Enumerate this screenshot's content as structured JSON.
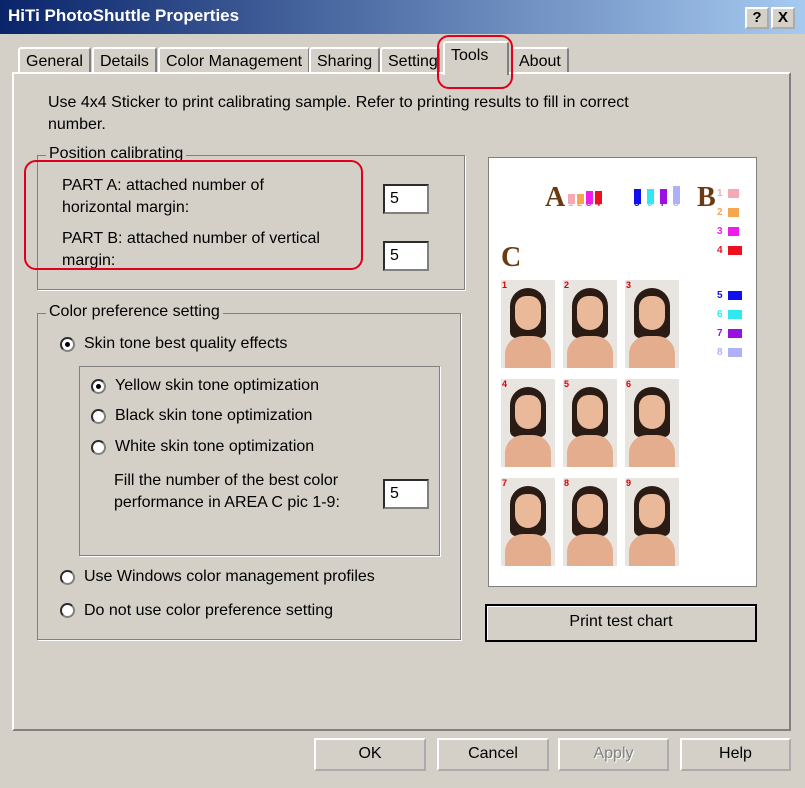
{
  "window": {
    "title": "HiTi PhotoShuttle Properties",
    "help": "?",
    "close": "X"
  },
  "tabs": [
    "General",
    "Details",
    "Color Management",
    "Sharing",
    "Setting",
    "Tools",
    "About"
  ],
  "active_tab": "Tools",
  "instructions": "Use 4x4 Sticker to print calibrating sample.  Refer to printing results to fill in correct number.",
  "position": {
    "label": "Position calibrating",
    "part_a": "PART A: attached number of horizontal margin:",
    "part_a_value": "5",
    "part_b": "PART B: attached number of vertical margin:",
    "part_b_value": "5"
  },
  "color": {
    "label": "Color preference setting",
    "skin": "Skin tone best quality effects",
    "yellow": "Yellow skin tone optimization",
    "black": "Black skin tone optimization",
    "white": "White skin tone optimization",
    "fill_label": "Fill the number of the best color performance in AREA C pic 1-9:",
    "fill_value": "5",
    "windows": "Use Windows color management profiles",
    "none": "Do not use color preference setting"
  },
  "preview": {
    "a": "A",
    "b": "B",
    "c": "C",
    "a_nums": [
      "1",
      "2",
      "3",
      "4",
      "5",
      "6",
      "7",
      "8"
    ],
    "b_nums": [
      "1",
      "2",
      "3",
      "4",
      "5",
      "6",
      "7",
      "8"
    ],
    "pics": [
      "1",
      "2",
      "3",
      "4",
      "5",
      "6",
      "7",
      "8",
      "9"
    ],
    "colors": [
      "#f6a9b4",
      "#f5a64f",
      "#ee1ee8",
      "#ee1020",
      "#1010ee",
      "#30e8ee",
      "#9b10e0",
      "#b0b0f8"
    ]
  },
  "print_button": "Print test chart",
  "buttons": {
    "ok": "OK",
    "cancel": "Cancel",
    "apply": "Apply",
    "help": "Help"
  }
}
